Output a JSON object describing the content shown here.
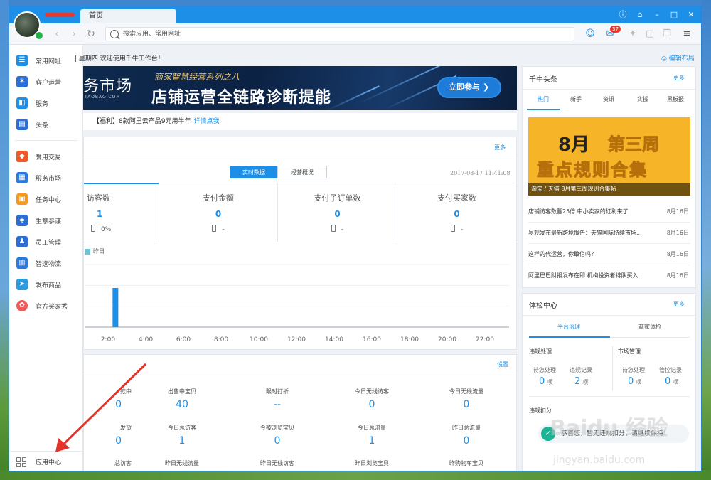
{
  "window": {
    "tab_label": "首页",
    "controls": [
      "ⓘ",
      "⌂",
      "–",
      "□",
      "✕"
    ]
  },
  "nav": {
    "search_placeholder": "搜索应用、常用网址",
    "mail_count": "37"
  },
  "sidebar": {
    "items": [
      {
        "label": "常用网址",
        "icon": "list-icon",
        "color": "#1e8fe6"
      },
      {
        "label": "客户运营",
        "icon": "star-icon",
        "color": "#2b6fd6"
      },
      {
        "label": "服务",
        "icon": "bag-icon",
        "color": "#1e8fe6"
      },
      {
        "label": "头条",
        "icon": "news-icon",
        "color": "#2b6fd6"
      },
      {
        "label": "爱用交易",
        "icon": "trade-icon",
        "color": "#f05a2a"
      },
      {
        "label": "服务市场",
        "icon": "market-icon",
        "color": "#2a7be0"
      },
      {
        "label": "任务中心",
        "icon": "task-icon",
        "color": "#f39a1e"
      },
      {
        "label": "生意参谋",
        "icon": "compass-icon",
        "color": "#2b6fd6"
      },
      {
        "label": "员工管理",
        "icon": "staff-icon",
        "color": "#2b6fd6"
      },
      {
        "label": "智选物流",
        "icon": "logistics-icon",
        "color": "#2a7be0"
      },
      {
        "label": "发布商品",
        "icon": "publish-icon",
        "color": "#2a9be0"
      },
      {
        "label": "官方买家秀",
        "icon": "buyer-show-icon",
        "color": "#ef5b5b"
      }
    ],
    "app_center_label": "应用中心"
  },
  "main": {
    "greeting": "星期四 欢迎使用千牛工作台！",
    "edit_layout": "编辑布局",
    "banner": {
      "brand": "务市场",
      "domain": "TAOBAO.COM",
      "subtitle": "商家智慧经营系列之八",
      "headline": "店铺运营全链路诊断提能",
      "button": "立即参与 ❯"
    },
    "notice": {
      "text": "【福利】8款阿里云产品9元用半年",
      "link": "详情点我"
    },
    "data_panel": {
      "more": "更多",
      "seg_realtime": "实时数据",
      "seg_overview": "经营概况",
      "timestamp": "2017-08-17 11:41:08",
      "metrics": [
        {
          "title": "访客数",
          "value": "1",
          "compare": "0%"
        },
        {
          "title": "支付金额",
          "value": "0",
          "compare": "-"
        },
        {
          "title": "支付子订单数",
          "value": "0",
          "compare": "-"
        },
        {
          "title": "支付买家数",
          "value": "0",
          "compare": "-"
        }
      ],
      "legend": "昨日"
    },
    "stats_panel": {
      "settings": "设置",
      "rows": [
        [
          {
            "label": "款中",
            "value": "0"
          },
          {
            "label": "出售中宝贝",
            "value": "40"
          },
          {
            "label": "限时打折",
            "value": "--"
          },
          {
            "label": "今日无线访客",
            "value": "0"
          },
          {
            "label": "今日无线流量",
            "value": "0"
          }
        ],
        [
          {
            "label": "发货",
            "value": "0"
          },
          {
            "label": "今日总访客",
            "value": "1"
          },
          {
            "label": "今被浏览宝贝",
            "value": "0"
          },
          {
            "label": "今日总流量",
            "value": "1"
          },
          {
            "label": "昨日总流量",
            "value": "0"
          }
        ],
        [
          {
            "label": "总访客",
            "value": ""
          },
          {
            "label": "昨日无线流量",
            "value": ""
          },
          {
            "label": "昨日无线访客",
            "value": ""
          },
          {
            "label": "昨日浏览宝贝",
            "value": ""
          },
          {
            "label": "昨购物车宝贝",
            "value": ""
          }
        ]
      ]
    }
  },
  "chart_data": {
    "type": "bar",
    "series": [
      {
        "name": "昨日",
        "color": "#1e8fe6"
      }
    ],
    "x": [
      "0:00",
      "1:00",
      "2:00",
      "3:00",
      "4:00",
      "5:00",
      "6:00",
      "7:00",
      "8:00",
      "9:00",
      "10:00",
      "11:00",
      "12:00",
      "13:00",
      "14:00",
      "15:00",
      "16:00",
      "17:00",
      "18:00",
      "19:00",
      "20:00",
      "21:00",
      "22:00",
      "23:00"
    ],
    "values": [
      0,
      1,
      0,
      0,
      0,
      0,
      0,
      0,
      0,
      0,
      0,
      0,
      0,
      0,
      0,
      0,
      0,
      0,
      0,
      0,
      0,
      0,
      0,
      0
    ],
    "tick_labels": [
      "2:00",
      "4:00",
      "6:00",
      "8:00",
      "10:00",
      "12:00",
      "14:00",
      "16:00",
      "18:00",
      "20:00",
      "22:00"
    ],
    "ylim": [
      0,
      1.6
    ],
    "grid": true
  },
  "right": {
    "headlines": {
      "title": "千牛头条",
      "more": "更多",
      "tabs": [
        "热门",
        "新手",
        "资讯",
        "实操",
        "黑板报"
      ],
      "image_line1": "8月",
      "image_line2": "第三周",
      "image_line3": "重点规则合集",
      "image_caption": "淘宝 / 天猫 8月第三周规则合集帖",
      "news": [
        {
          "title": "店铺访客数翻25倍 中小卖家的红利来了",
          "date": "8月16日"
        },
        {
          "title": "易观发布最新跨境报告：天猫国际持续市场...",
          "date": "8月16日"
        },
        {
          "title": "这样的代运营，你敢信吗？",
          "date": "8月16日"
        },
        {
          "title": "阿里巴巴财报发布在即 机构投资者排队买入",
          "date": "8月16日"
        }
      ]
    },
    "health": {
      "title": "体检中心",
      "more": "更多",
      "tabs": [
        "平台治理",
        "商家体检"
      ],
      "violation_title": "违规处理",
      "market_title": "市场管理",
      "items": [
        {
          "label": "待您处理",
          "value": "0",
          "unit": "项"
        },
        {
          "label": "违规记录",
          "value": "2",
          "unit": "项"
        },
        {
          "label": "待您处理",
          "value": "0",
          "unit": "项"
        },
        {
          "label": "管控记录",
          "value": "0",
          "unit": "项"
        }
      ],
      "deduction_title": "违规扣分",
      "tip": "恭喜您，暂无违规扣分，请继续保持！"
    }
  },
  "watermark": {
    "text": "Baidu 经验",
    "url": "jingyan.baidu.com"
  }
}
